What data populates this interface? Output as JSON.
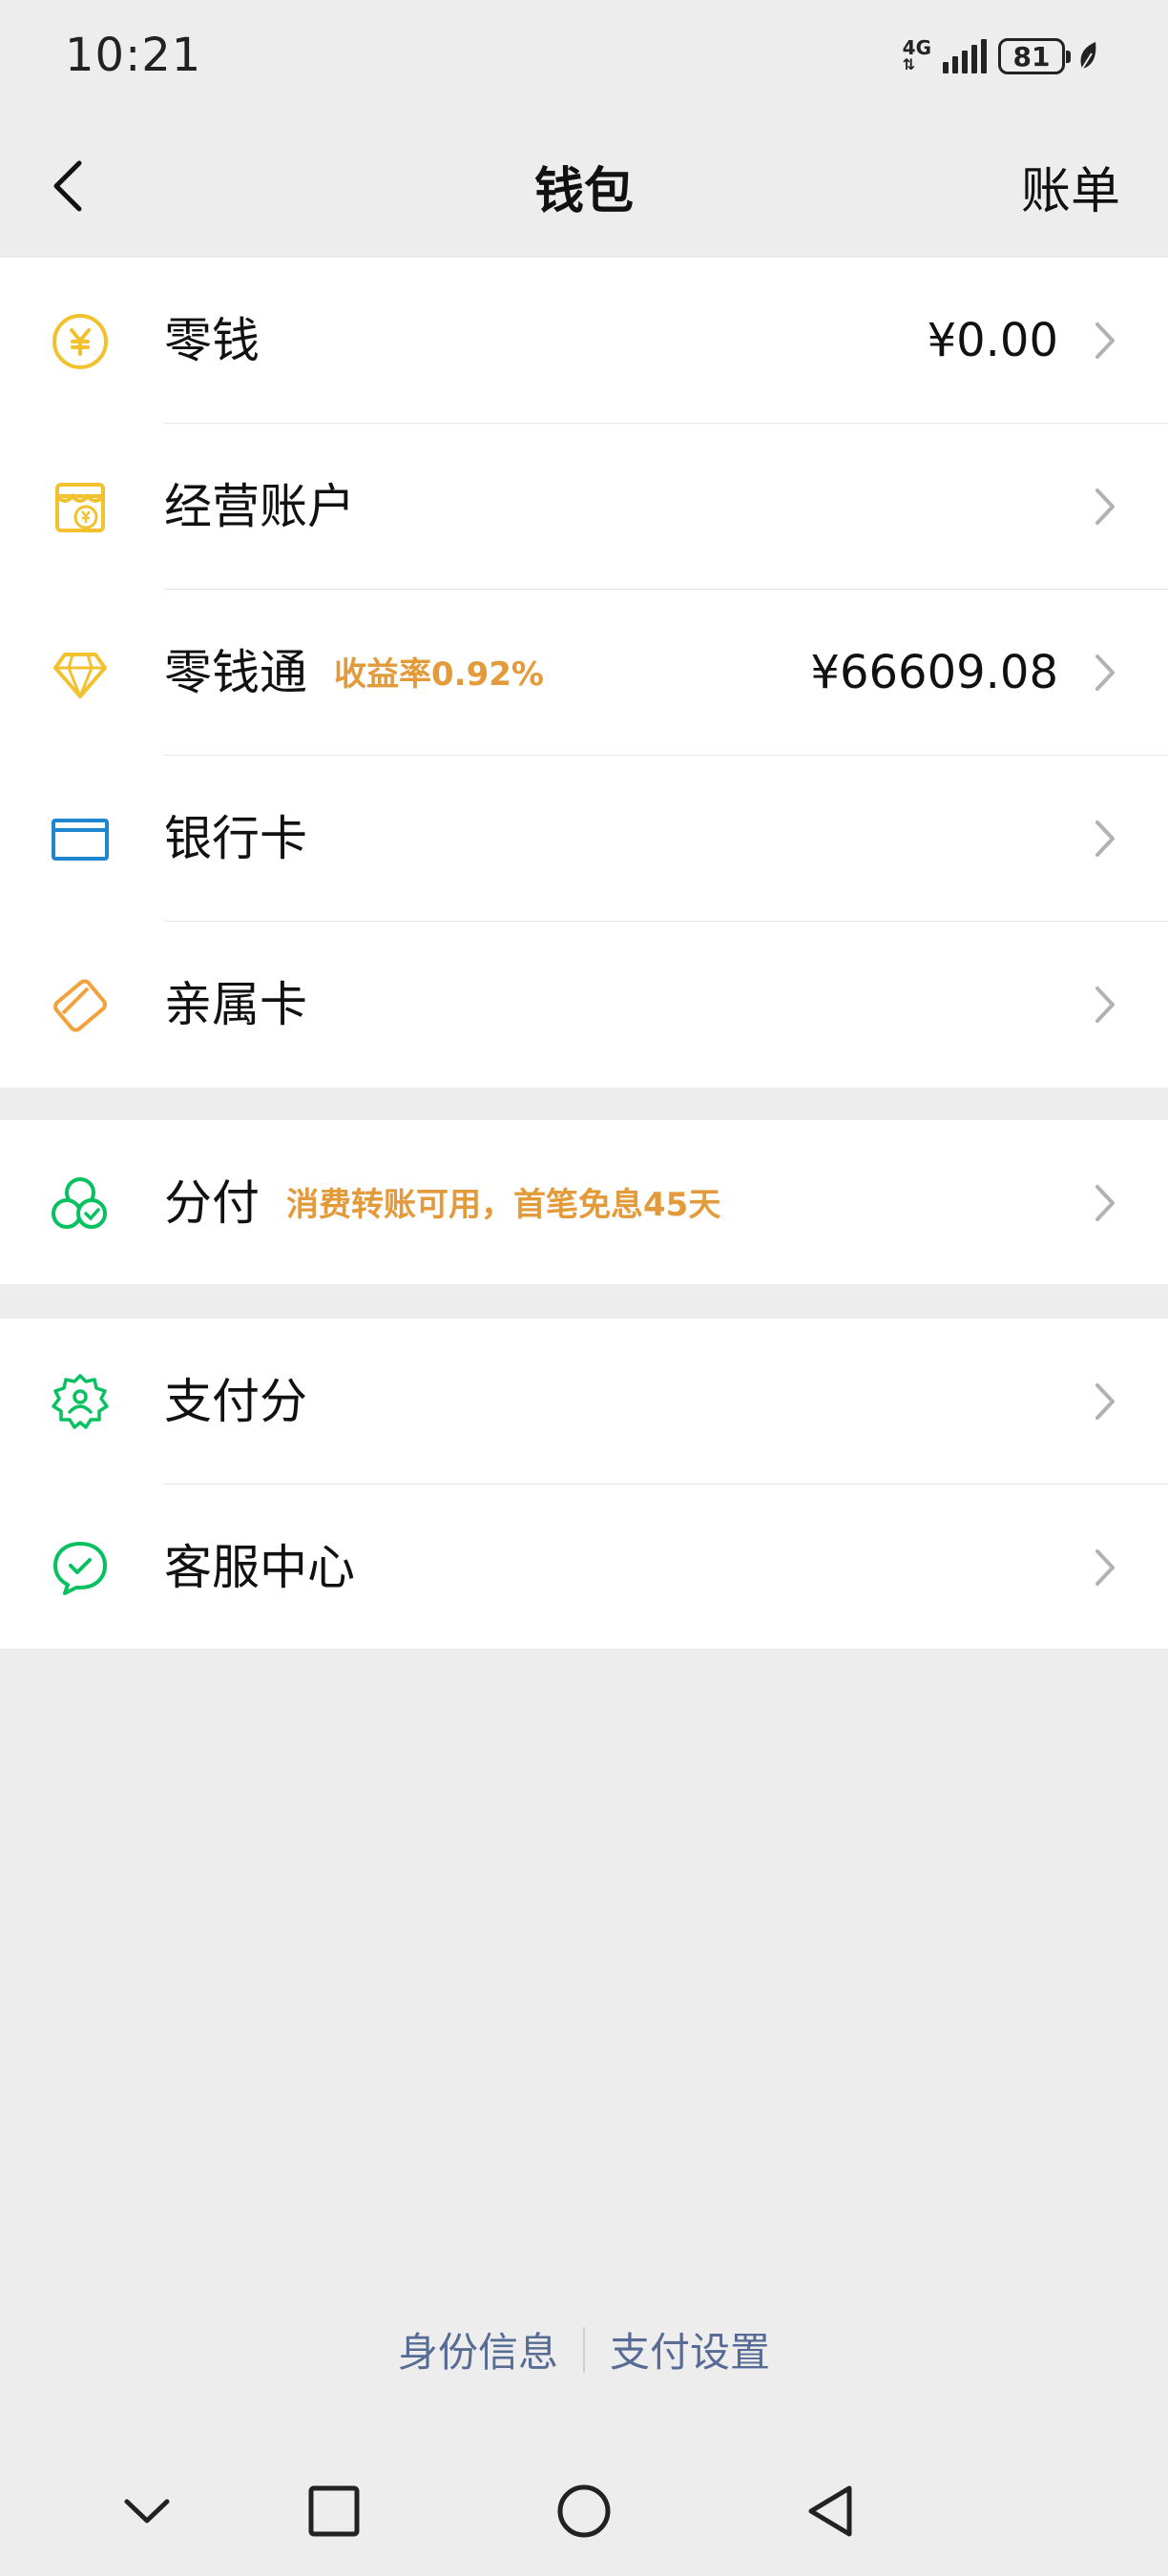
{
  "status_bar": {
    "time": "10:21",
    "network": "4G",
    "battery": "81"
  },
  "nav": {
    "title": "钱包",
    "right_action": "账单"
  },
  "groups": [
    {
      "items": [
        {
          "label": "零钱",
          "value": "¥0.00",
          "icon": "coin-yen-icon",
          "color": "#f2c12e"
        },
        {
          "label": "经营账户",
          "value": "",
          "icon": "shop-account-icon",
          "color": "#f2c12e"
        },
        {
          "label": "零钱通",
          "tag": "收益率0.92%",
          "value": "¥66609.08",
          "icon": "diamond-icon",
          "color": "#f2c12e"
        },
        {
          "label": "银行卡",
          "value": "",
          "icon": "bank-card-icon",
          "color": "#1f86d1"
        },
        {
          "label": "亲属卡",
          "value": "",
          "icon": "family-card-icon",
          "color": "#f2a23c"
        }
      ]
    },
    {
      "items": [
        {
          "label": "分付",
          "tag": "消费转账可用，首笔免息45天",
          "value": "",
          "icon": "fenfu-icon",
          "color": "#07c160"
        }
      ]
    },
    {
      "items": [
        {
          "label": "支付分",
          "value": "",
          "icon": "pay-score-icon",
          "color": "#07c160"
        },
        {
          "label": "客服中心",
          "value": "",
          "icon": "customer-service-icon",
          "color": "#07c160"
        }
      ]
    }
  ],
  "footer": {
    "link_identity": "身份信息",
    "link_settings": "支付设置"
  },
  "colors": {
    "background": "#ededed",
    "tag": "#e39a3b",
    "link": "#576b95"
  }
}
